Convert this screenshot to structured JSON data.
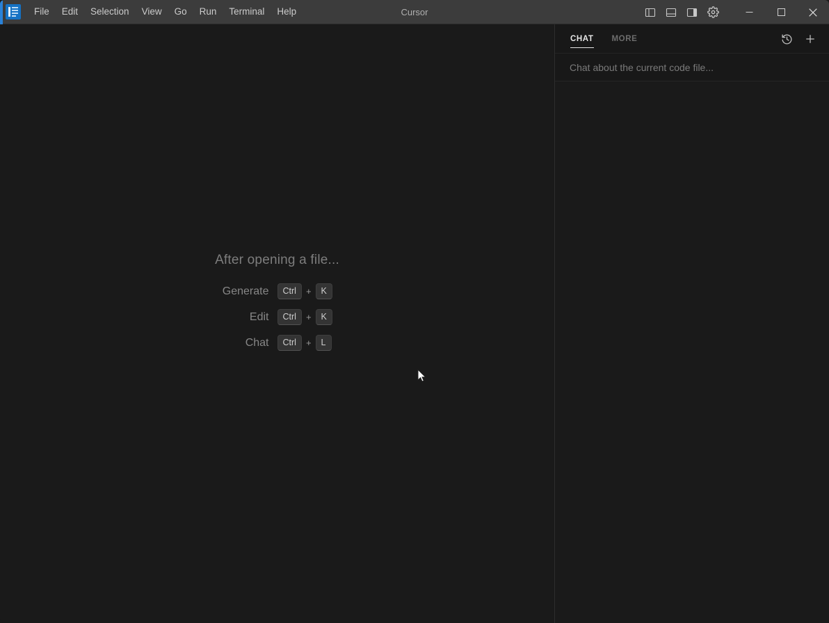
{
  "window": {
    "title": "Cursor",
    "logo_icon": "cursor-book-logo-icon"
  },
  "menubar": {
    "items": [
      {
        "label": "File"
      },
      {
        "label": "Edit"
      },
      {
        "label": "Selection"
      },
      {
        "label": "View"
      },
      {
        "label": "Go"
      },
      {
        "label": "Run"
      },
      {
        "label": "Terminal"
      },
      {
        "label": "Help"
      }
    ]
  },
  "titlebar_actions": {
    "layout_buttons": [
      {
        "name": "toggle-primary-sidebar-icon",
        "tooltip": "Toggle Primary Side Bar"
      },
      {
        "name": "toggle-panel-icon",
        "tooltip": "Toggle Panel"
      },
      {
        "name": "toggle-secondary-sidebar-icon",
        "tooltip": "Toggle Secondary Side Bar"
      },
      {
        "name": "settings-gear-icon",
        "tooltip": "Manage"
      }
    ],
    "window_buttons": [
      {
        "name": "minimize-button",
        "glyph": "—"
      },
      {
        "name": "maximize-button",
        "glyph": "□"
      },
      {
        "name": "close-button",
        "glyph": "✕"
      }
    ]
  },
  "editor": {
    "hints_title": "After opening a file...",
    "shortcuts": [
      {
        "label": "Generate",
        "modifier": "Ctrl",
        "separator": "+",
        "key": "K"
      },
      {
        "label": "Edit",
        "modifier": "Ctrl",
        "separator": "+",
        "key": "K"
      },
      {
        "label": "Chat",
        "modifier": "Ctrl",
        "separator": "+",
        "key": "L"
      }
    ]
  },
  "chat_panel": {
    "tabs": [
      {
        "label": "CHAT",
        "active": true
      },
      {
        "label": "MORE",
        "active": false
      }
    ],
    "actions": [
      {
        "name": "chat-history-icon"
      },
      {
        "name": "new-chat-icon"
      }
    ],
    "input_placeholder": "Chat about the current code file..."
  },
  "colors": {
    "titlebar_bg": "#3c3c3c",
    "editor_bg": "#1a1a1a",
    "chat_bg": "#181818",
    "accent_blue": "#2a82d8",
    "logo_blue": "#1572c4",
    "text_muted": "#7d7d7d",
    "text_primary": "#e6e6e6"
  }
}
